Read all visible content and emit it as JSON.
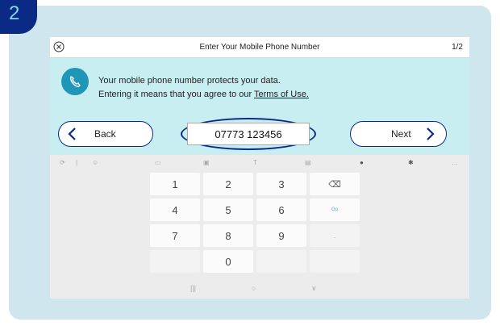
{
  "step_badge": "2",
  "titlebar": {
    "title": "Enter Your Mobile Phone Number",
    "step_count": "1/2",
    "close_icon": "close-circle-icon"
  },
  "message": {
    "line1": "Your mobile phone number protects your data.",
    "line2_prefix": "Entering it means that you agree to our ",
    "link_text": "Terms of Use."
  },
  "buttons": {
    "back_label": "Back",
    "next_label": "Next"
  },
  "phone_input": {
    "value": "07773 123456"
  },
  "keyboard": {
    "toolbar_icons": [
      "sync-icon",
      "emoji-icon",
      "sticker-icon",
      "gif-icon",
      "text-style-icon",
      "clipboard-icon",
      "mic-icon",
      "settings-icon",
      "more-icon"
    ],
    "keys": [
      "1",
      "2",
      "3",
      "⌫",
      "4",
      "5",
      "6",
      "Go",
      "7",
      "8",
      "9",
      ".",
      "",
      "0",
      "",
      ""
    ],
    "nav": [
      "|||",
      "○",
      "∨"
    ]
  },
  "colors": {
    "accent": "#0a2a86",
    "frame": "#cfe6ee",
    "content_bg": "#c8eef2",
    "icon_circle": "#1f96b8"
  }
}
